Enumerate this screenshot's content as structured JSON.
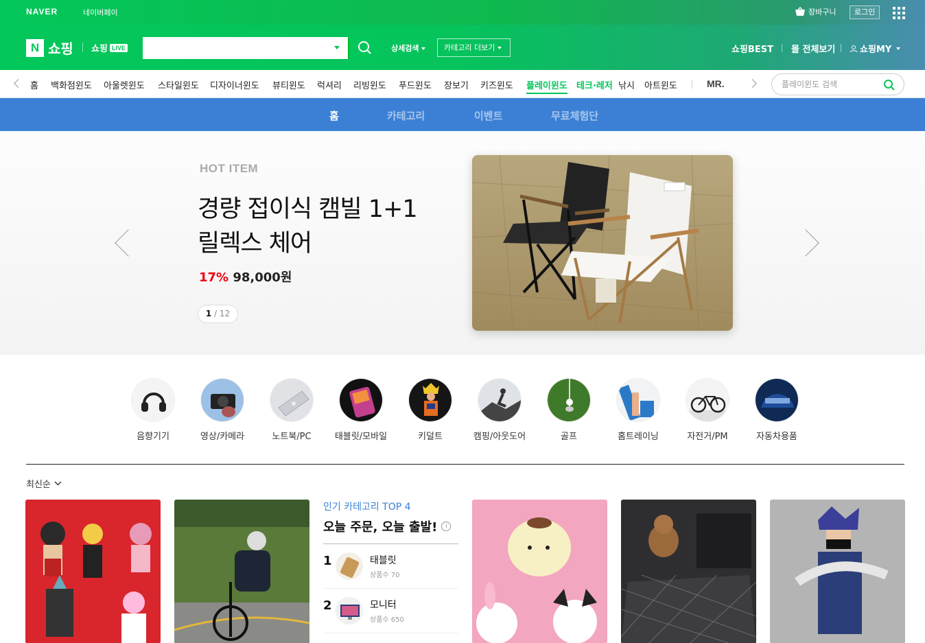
{
  "topbar": {
    "naver": "NAVER",
    "naverpay": "네이버페이",
    "cart": "장바구니",
    "login": "로그인"
  },
  "header": {
    "logo_n": "N",
    "shopping": "쇼핑",
    "shoplive": "쇼핑",
    "live_badge": "LIVE",
    "search_placeholder": "",
    "detail_search": "상세검색",
    "category_more": "카테고리 더보기",
    "nav": [
      "쇼핑BEST",
      "몰 전체보기",
      "쇼핑MY"
    ]
  },
  "categories": {
    "items": [
      "홈",
      "백화점윈도",
      "아울렛윈도",
      "스타일윈도",
      "디자이너윈도",
      "뷰티윈도",
      "럭셔리",
      "리빙윈도",
      "푸드윈도",
      "장보기",
      "키즈윈도",
      "플레이윈도",
      "테크·레저",
      "낚시",
      "아트윈도",
      "MR."
    ],
    "active": "플레이윈도",
    "search_placeholder": "플레이윈도 검색"
  },
  "subnav": {
    "tabs": [
      "홈",
      "카테고리",
      "이벤트",
      "무료체험단"
    ],
    "active": "홈"
  },
  "banner": {
    "eyebrow": "HOT ITEM",
    "title_line1": "경량 접이식 캠빌 1+1",
    "title_line2": "릴렉스 체어",
    "discount": "17%",
    "price": "98,000원",
    "page_current": "1",
    "page_sep": "/",
    "page_total": "12"
  },
  "circle_categories": [
    "음향기기",
    "영상/카메라",
    "노트북/PC",
    "태블릿/모바일",
    "키덜트",
    "캠핑/아웃도어",
    "골프",
    "홈트레이닝",
    "자전거/PM",
    "자동차용품"
  ],
  "sort": {
    "label": "최신순"
  },
  "top4": {
    "title": "인기 카테고리 TOP 4",
    "headline": "오늘 주문, 오늘 출발!",
    "info": "i",
    "ranks": [
      {
        "num": "1",
        "name": "태블릿",
        "count": "상품수 70"
      },
      {
        "num": "2",
        "name": "모니터",
        "count": "상품수 650"
      }
    ]
  },
  "colors": {
    "brand_green": "#03c75a",
    "subnav_blue": "#3c80d6",
    "discount_red": "#e01"
  }
}
